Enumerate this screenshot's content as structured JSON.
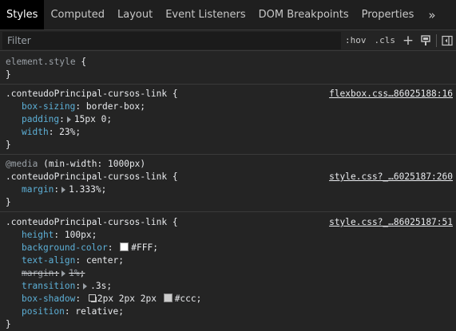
{
  "tabs": [
    {
      "label": "Styles"
    },
    {
      "label": "Computed"
    },
    {
      "label": "Layout"
    },
    {
      "label": "Event Listeners"
    },
    {
      "label": "DOM Breakpoints"
    },
    {
      "label": "Properties"
    }
  ],
  "more_tabs": "»",
  "toolbar": {
    "filter_placeholder": "Filter",
    "hov": ":hov",
    "cls": ".cls",
    "add": "+"
  },
  "rules": {
    "element_style": {
      "selector": "element.style",
      "open": "{",
      "close": "}"
    },
    "rule1": {
      "selector": ".conteudoPrincipal-cursos-link",
      "source": "flexbox.css…86025188:16",
      "decls": [
        {
          "prop": "box-sizing",
          "value": "border-box"
        },
        {
          "prop": "padding",
          "value": "15px 0"
        },
        {
          "prop": "width",
          "value": "23%"
        }
      ]
    },
    "rule2": {
      "at": "@media",
      "media": "(min-width: 1000px)",
      "selector": ".conteudoPrincipal-cursos-link",
      "source": "style.css?_…6025187:260",
      "decls": [
        {
          "prop": "margin",
          "value": "1.333%"
        }
      ]
    },
    "rule3": {
      "selector": ".conteudoPrincipal-cursos-link",
      "source": "style.css?_…86025187:51",
      "decls": [
        {
          "prop": "height",
          "value": "100px"
        },
        {
          "prop": "background-color",
          "value": "#FFF",
          "swatch": "#ffffff"
        },
        {
          "prop": "text-align",
          "value": "center"
        },
        {
          "prop": "margin",
          "value": "1%"
        },
        {
          "prop": "transition",
          "value": ".3s"
        },
        {
          "prop": "box-shadow",
          "value_a": "2px 2px 2px",
          "value_b": "#ccc",
          "swatch": "#cccccc"
        },
        {
          "prop": "position",
          "value": "relative"
        }
      ]
    }
  }
}
